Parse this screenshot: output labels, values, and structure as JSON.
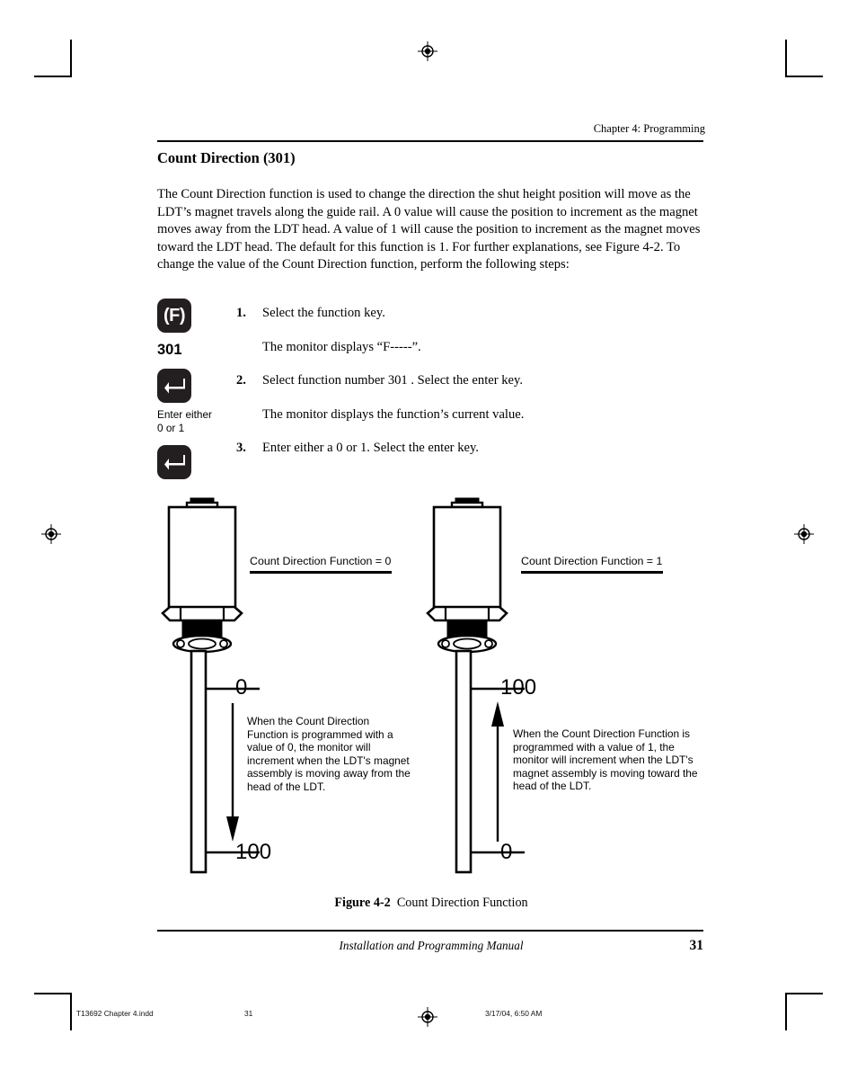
{
  "page": {
    "running_head": "Chapter 4:  Programming",
    "section_title": "Count Direction (301)",
    "body_paragraph": "The Count Direction function is used to change the direction the shut height position will move as the LDT’s magnet travels along the guide rail. A 0 value will cause the position to increment as the magnet moves away from the LDT head. A value of 1 will cause the position to increment as the magnet moves toward the LDT head. The default for this function is 1. For further explanations, see Figure 4-2. To change the value of the Count Direction function, perform the following steps:",
    "figure_caption_label": "Figure 4-2",
    "figure_caption_text": "Count Direction Function",
    "footer_title": "Installation and Programming Manual",
    "page_number": "31"
  },
  "keys": [
    {
      "icon": "function-key-icon",
      "label": "(F)"
    },
    {
      "icon": "enter-key-icon",
      "label": "↵"
    },
    {
      "icon": "enter-key-icon",
      "label": "↵"
    }
  ],
  "key_annotations": {
    "function_number": "301",
    "enter_hint_line1": "Enter either",
    "enter_hint_line2": "0 or 1"
  },
  "steps": [
    {
      "num": "1.",
      "text": "Select the function key."
    },
    {
      "num": "",
      "text": "The monitor displays “F-----”."
    },
    {
      "num": "2.",
      "text": "Select function number 301 . Select the enter key."
    },
    {
      "num": "",
      "text": "The monitor displays the function’s current value."
    },
    {
      "num": "3.",
      "text": "Enter either a 0 or 1. Select the enter key."
    }
  ],
  "figure": {
    "left": {
      "title": "Count Direction Function = 0",
      "top_value": "0",
      "bottom_value": "100",
      "arrow_direction": "down",
      "note": "When the Count Direction Function is programmed with a value of 0, the monitor will increment when the LDT's magnet assembly is moving away from the head of the LDT."
    },
    "right": {
      "title": "Count Direction Function = 1",
      "top_value": "100",
      "bottom_value": "0",
      "arrow_direction": "up",
      "note": "When the Count Direction Function is programmed with a value of 1, the monitor will increment when the LDT's magnet assembly is moving toward the head of the LDT."
    }
  },
  "print_marks": {
    "file_name": "T13692 Chapter 4.indd",
    "sheet_page": "31",
    "timestamp": "3/17/04, 6:50 AM"
  },
  "colors": {
    "ink": "#000000",
    "key_fill": "#231f20",
    "paper": "#ffffff"
  }
}
